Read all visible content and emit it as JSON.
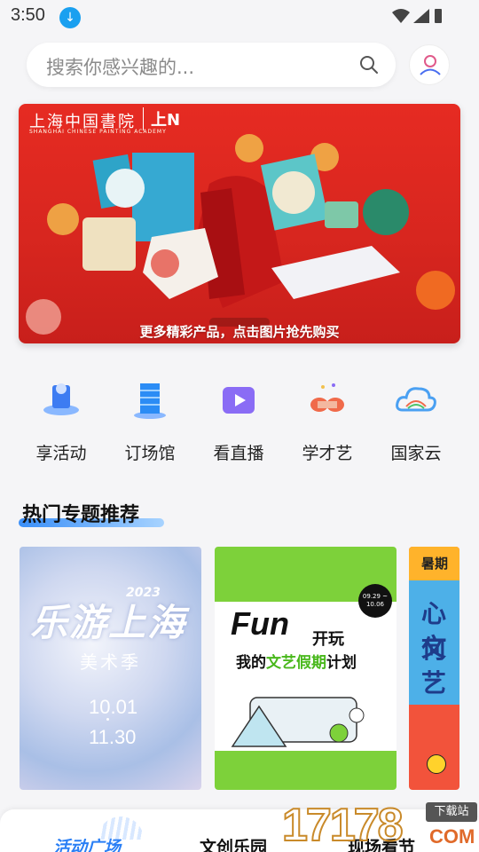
{
  "status_bar": {
    "time": "3:50"
  },
  "search": {
    "placeholder": "搜索你感兴趣的..."
  },
  "banner": {
    "brand": "上海中国書院",
    "brand_en": "SHANGHAI CHINESE PAINTING ACADEMY",
    "brand_mark": "上N",
    "cta": "更多精彩产品，点击图片抢先购买"
  },
  "categories": [
    {
      "label": "享活动",
      "icon": "event-icon"
    },
    {
      "label": "订场馆",
      "icon": "venue-icon"
    },
    {
      "label": "看直播",
      "icon": "live-icon"
    },
    {
      "label": "学才艺",
      "icon": "talent-icon"
    },
    {
      "label": "国家云",
      "icon": "cloud-icon"
    }
  ],
  "section": {
    "title": "热门专题推荐"
  },
  "cards": {
    "card1": {
      "title": "乐游上海",
      "year": "2023",
      "subtitle": "美术季",
      "date_start": "10.01",
      "date_end": "11.30"
    },
    "card2": {
      "title_en": "Fun",
      "title_cn": "开玩",
      "plan_prefix": "我的",
      "plan_highlight": "文艺假期",
      "plan_suffix": "计划",
      "date": "09.29 ~ 10.06"
    },
    "card3": {
      "tag": "暑期",
      "line1": "心何",
      "line2": "文艺"
    }
  },
  "tabbar": {
    "tabs": [
      "活动广场",
      "文创乐园",
      "现场看节"
    ]
  },
  "watermark": {
    "number": "17178",
    "tag": "下载站",
    "com": "COM"
  }
}
